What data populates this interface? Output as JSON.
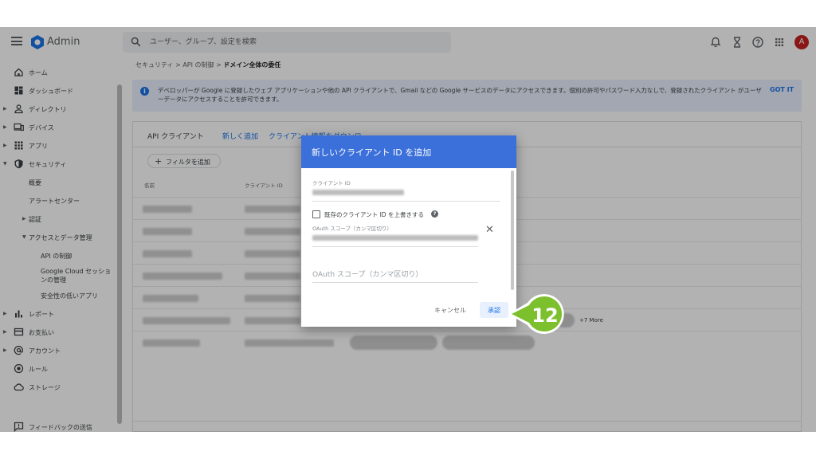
{
  "app": {
    "brand": "Admin"
  },
  "search": {
    "placeholder": "ユーザー、グループ、設定を検索"
  },
  "header_icons": [
    "bell-icon",
    "hourglass-icon",
    "help-icon",
    "apps-grid-icon"
  ],
  "user": {
    "avatar_initial": "A",
    "avatar_color": "#c5221f"
  },
  "sidebar": {
    "items": [
      {
        "label": "ホーム",
        "icon": "home-icon"
      },
      {
        "label": "ダッシュボード",
        "icon": "dashboard-icon"
      },
      {
        "label": "ディレクトリ",
        "icon": "person-icon"
      },
      {
        "label": "デバイス",
        "icon": "devices-icon"
      },
      {
        "label": "アプリ",
        "icon": "apps-icon"
      },
      {
        "label": "セキュリティ",
        "icon": "shield-icon"
      },
      {
        "label": "概要"
      },
      {
        "label": "アラートセンター"
      },
      {
        "label": "認証"
      },
      {
        "label": "アクセスとデータ管理"
      },
      {
        "label": "API の制御"
      },
      {
        "label": "Google Cloud セッションの管理"
      },
      {
        "label": "安全性の低いアプリ"
      },
      {
        "label": "レポート",
        "icon": "reports-icon"
      },
      {
        "label": "お支払い",
        "icon": "billing-icon"
      },
      {
        "label": "アカウント",
        "icon": "at-icon"
      },
      {
        "label": "ルール",
        "icon": "rules-icon"
      },
      {
        "label": "ストレージ",
        "icon": "cloud-icon"
      }
    ],
    "feedback": "フィードバックの送信"
  },
  "breadcrumb": {
    "part1": "セキュリティ",
    "sep": ">",
    "part2": "API の制御",
    "current": "ドメイン全体の委任"
  },
  "banner": {
    "text": "デベロッパーが Google に登録したウェブ アプリケーションや他の API クライアントで、Gmail などの Google サービスのデータにアクセスできます。個別の許可やパスワード入力なしで、登録されたクライアント がユーザーデータにアクセスすることを許可できます。",
    "got_it": "GOT IT"
  },
  "card": {
    "title": "API クライアント",
    "add_new": "新しく追加",
    "download": "クライアント情報をダウンロー...",
    "filter": "フィルタを追加",
    "col_name": "名前",
    "col_client_id": "クライアント ID",
    "more_label": "+7 More"
  },
  "dialog": {
    "title": "新しいクライアント ID を追加",
    "client_id_label": "クライアント ID",
    "overwrite_label": "既存のクライアント ID を上書きする",
    "overwrite_checked": false,
    "scope_label": "OAuth スコープ（カンマ区切り）",
    "scope_placeholder": "OAuth スコープ（カンマ区切り）",
    "cancel": "キャンセル",
    "approve": "承認",
    "header_color": "#3b6fd9"
  },
  "callout": {
    "step": "12",
    "color": "#7dc02d"
  }
}
